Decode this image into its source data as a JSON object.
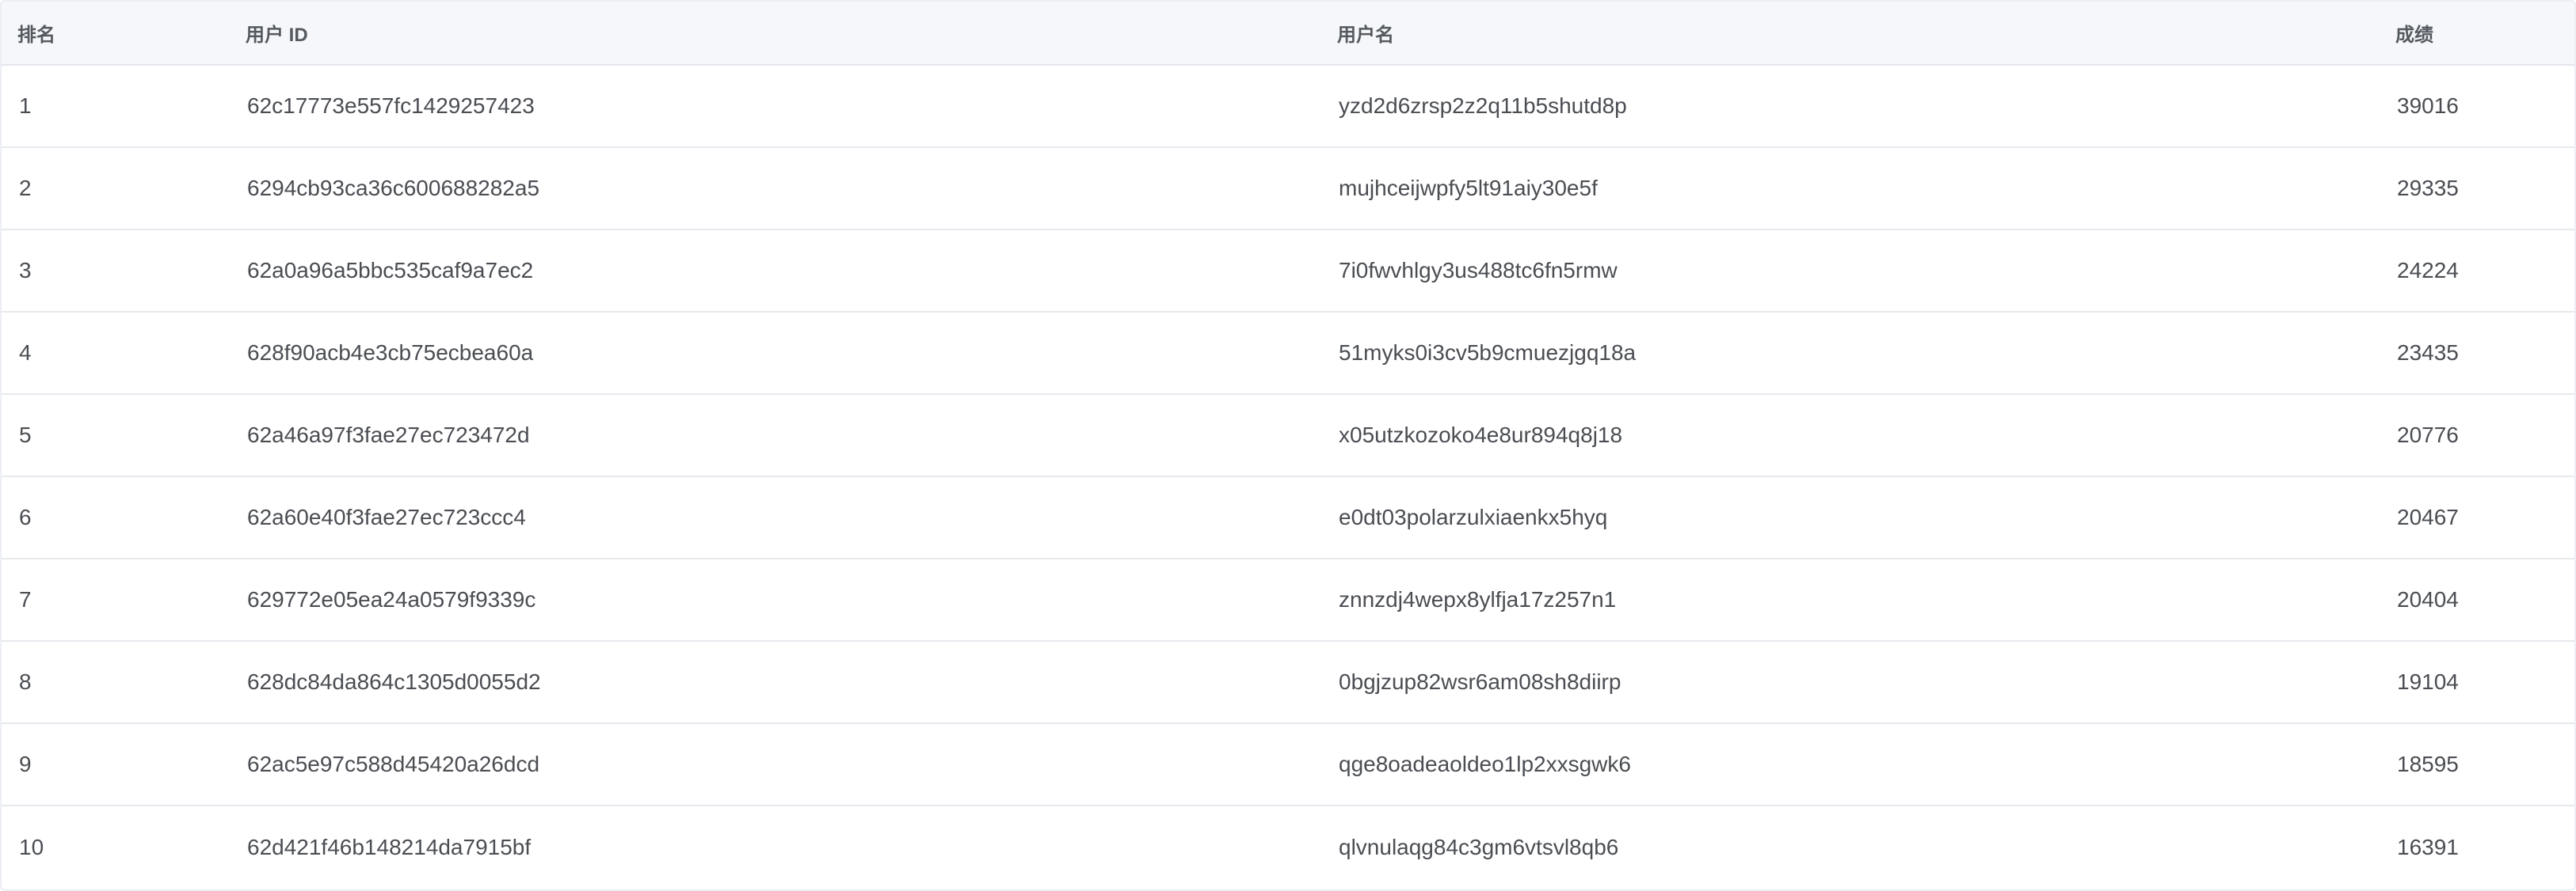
{
  "leaderboard": {
    "columns": {
      "rank": "排名",
      "user_id": "用户 ID",
      "username": "用户名",
      "score": "成绩"
    },
    "rows": [
      {
        "rank": "1",
        "user_id": "62c17773e557fc1429257423",
        "username": "yzd2d6zrsp2z2q11b5shutd8p",
        "score": "39016"
      },
      {
        "rank": "2",
        "user_id": "6294cb93ca36c600688282a5",
        "username": "mujhceijwpfy5lt91aiy30e5f",
        "score": "29335"
      },
      {
        "rank": "3",
        "user_id": "62a0a96a5bbc535caf9a7ec2",
        "username": "7i0fwvhlgy3us488tc6fn5rmw",
        "score": "24224"
      },
      {
        "rank": "4",
        "user_id": "628f90acb4e3cb75ecbea60a",
        "username": "51myks0i3cv5b9cmuezjgq18a",
        "score": "23435"
      },
      {
        "rank": "5",
        "user_id": "62a46a97f3fae27ec723472d",
        "username": "x05utzkozoko4e8ur894q8j18",
        "score": "20776"
      },
      {
        "rank": "6",
        "user_id": "62a60e40f3fae27ec723ccc4",
        "username": "e0dt03polarzulxiaenkx5hyq",
        "score": "20467"
      },
      {
        "rank": "7",
        "user_id": "629772e05ea24a0579f9339c",
        "username": "znnzdj4wepx8ylfja17z257n1",
        "score": "20404"
      },
      {
        "rank": "8",
        "user_id": "628dc84da864c1305d0055d2",
        "username": "0bgjzup82wsr6am08sh8diirp",
        "score": "19104"
      },
      {
        "rank": "9",
        "user_id": "62ac5e97c588d45420a26dcd",
        "username": "qge8oadeaoldeo1lp2xxsgwk6",
        "score": "18595"
      },
      {
        "rank": "10",
        "user_id": "62d421f46b148214da7915bf",
        "username": "qlvnulaqg84c3gm6vtsvl8qb6",
        "score": "16391"
      }
    ]
  }
}
